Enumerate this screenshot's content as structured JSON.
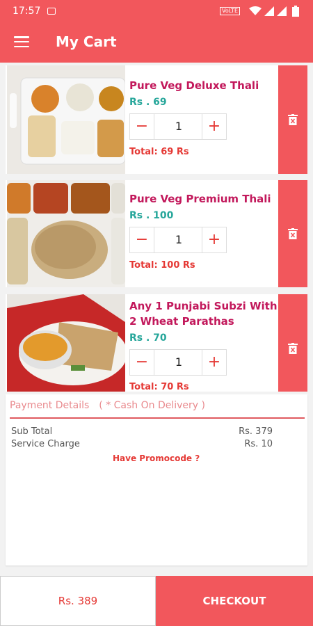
{
  "status_bar": {
    "time": "17:57",
    "volte": "VoLTE"
  },
  "app_bar": {
    "title": "My Cart"
  },
  "items": [
    {
      "name": "Pure Veg Deluxe Thali",
      "price": "Rs . 69",
      "qty": "1",
      "total": "Total: 69 Rs"
    },
    {
      "name": "Pure Veg Premium Thali",
      "price": "Rs . 100",
      "qty": "1",
      "total": "Total: 100 Rs"
    },
    {
      "name": "Any 1 Punjabi Subzi With 2 Wheat Parathas",
      "price": "Rs . 70",
      "qty": "1",
      "total": "Total: 70 Rs"
    }
  ],
  "stepper": {
    "minus": "−",
    "plus": "+"
  },
  "payment": {
    "heading": "Payment Details",
    "mode": "( * Cash On Delivery )",
    "rows": [
      {
        "label": "Sub Total",
        "value": "Rs. 379"
      },
      {
        "label": "Service Charge",
        "value": "Rs. 10"
      }
    ],
    "promo": "Have Promocode ?"
  },
  "footer": {
    "total": "Rs. 389",
    "checkout": "CHECKOUT"
  },
  "colors": {
    "primary": "#f2575c",
    "item_name": "#c2185b",
    "price": "#26a69a",
    "accent": "#e53935"
  }
}
